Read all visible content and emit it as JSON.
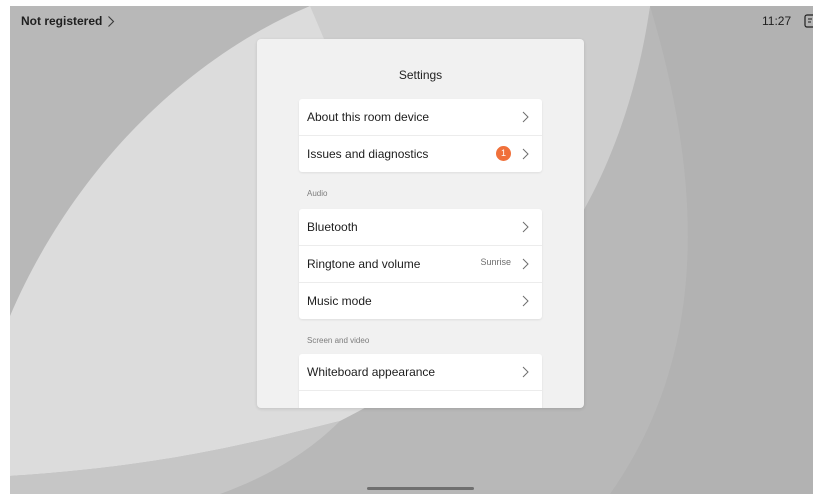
{
  "status": {
    "registration": "Not registered",
    "time": "11:27"
  },
  "settings": {
    "title": "Settings",
    "general": [
      {
        "label": "About this room device"
      },
      {
        "label": "Issues and diagnostics",
        "badge": "1"
      }
    ],
    "audio": {
      "header": "Audio",
      "items": [
        {
          "label": "Bluetooth"
        },
        {
          "label": "Ringtone and volume",
          "value": "Sunrise"
        },
        {
          "label": "Music mode"
        }
      ]
    },
    "screen_video": {
      "header": "Screen and video",
      "items": [
        {
          "label": "Whiteboard appearance"
        }
      ]
    }
  },
  "colors": {
    "badge": "#f0703a",
    "panel_bg": "#f1f1f1",
    "screen_bg": "#b9b9b9"
  },
  "icons": [
    "chevron-right-icon",
    "clock-menu-icon"
  ]
}
